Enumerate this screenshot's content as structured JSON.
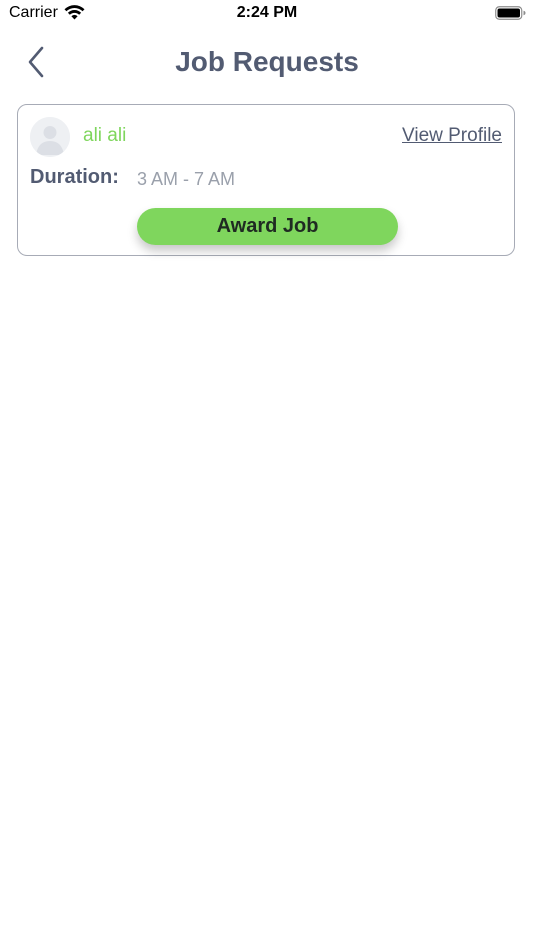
{
  "status_bar": {
    "carrier": "Carrier",
    "time": "2:24 PM",
    "wifi_icon": "wifi-icon",
    "battery_icon": "battery-icon"
  },
  "nav": {
    "back_icon": "chevron-left-icon",
    "title": "Job Requests"
  },
  "requests": [
    {
      "avatar_icon": "user-placeholder-icon",
      "name": "ali ali",
      "view_profile_label": "View Profile",
      "duration_label": "Duration:",
      "duration_value": "3 AM - 7 AM",
      "award_label": "Award Job"
    }
  ],
  "colors": {
    "accent_green": "#7fd65d",
    "title_text": "#525b72",
    "muted_text": "#9aa0ab",
    "card_border": "#a7abb6"
  }
}
